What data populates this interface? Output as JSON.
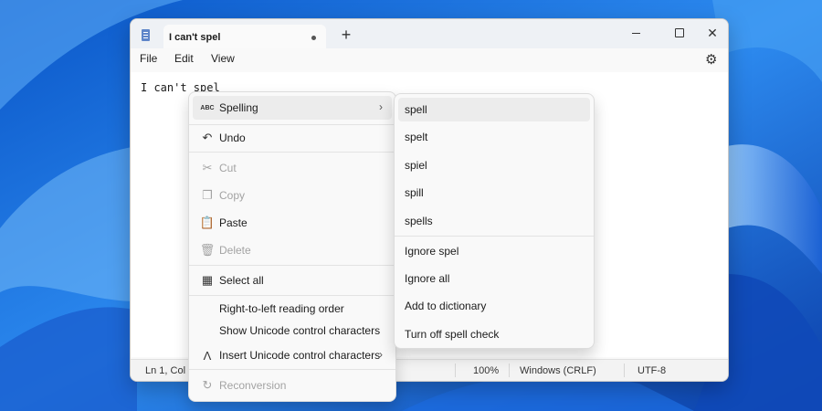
{
  "window": {
    "tab_title": "I can't spel",
    "new_tab": "+",
    "close_glyph": "✕"
  },
  "menubar": {
    "file": "File",
    "edit": "Edit",
    "view": "View"
  },
  "editor": {
    "text_before": "I can't ",
    "misspelled_word": "spel"
  },
  "statusbar": {
    "position": "Ln 1, Col 9",
    "zoom": "100%",
    "line_ending": "Windows (CRLF)",
    "encoding": "UTF-8"
  },
  "context_menu": {
    "spelling": "Spelling",
    "undo": "Undo",
    "cut": "Cut",
    "copy": "Copy",
    "paste": "Paste",
    "delete": "Delete",
    "select_all": "Select all",
    "rtl": "Right-to-left reading order",
    "show_unicode": "Show Unicode control characters",
    "insert_unicode": "Insert Unicode control characters",
    "reconversion": "Reconversion",
    "abc_glyph": "ABC"
  },
  "spelling_submenu": {
    "suggestions": [
      "spell",
      "spelt",
      "spiel",
      "spill",
      "spells"
    ],
    "ignore_word": "Ignore spel",
    "ignore_all": "Ignore all",
    "add_to_dictionary": "Add to dictionary",
    "turn_off": "Turn off spell check"
  },
  "colors": {
    "accent": "#1f5fd1",
    "misspell_underline": "#d13438",
    "menu_bg": "#f9f9f9"
  },
  "icons": [
    "notepad-icon",
    "minimize-icon",
    "maximize-icon",
    "close-icon",
    "gear-icon",
    "spellcheck-icon",
    "undo-icon",
    "cut-icon",
    "copy-icon",
    "paste-icon",
    "delete-icon",
    "select-all-icon",
    "insert-unicode-icon",
    "reconversion-icon",
    "chevron-right-icon"
  ]
}
